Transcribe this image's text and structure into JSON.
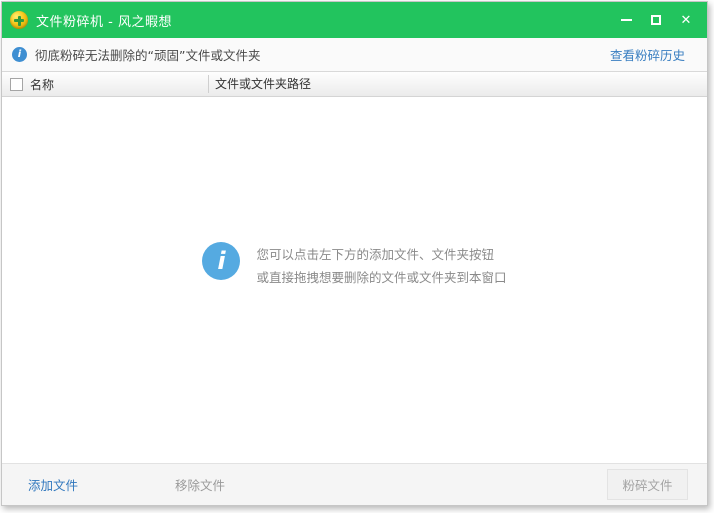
{
  "window": {
    "title": "文件粉碎机 - 风之暇想"
  },
  "infobar": {
    "text": "彻底粉碎无法删除的“顽固”文件或文件夹",
    "history_link": "查看粉碎历史"
  },
  "table": {
    "columns": [
      "名称",
      "文件或文件夹路径"
    ],
    "rows": []
  },
  "empty_hint": {
    "line1": "您可以点击左下方的添加文件、文件夹按钮",
    "line2": "或直接拖拽想要删除的文件或文件夹到本窗口"
  },
  "footer": {
    "add_label": "添加文件",
    "remove_label": "移除文件",
    "shred_label": "粉碎文件"
  },
  "icons": {
    "info_glyph": "i",
    "close_glyph": "✕"
  },
  "colors": {
    "titlebar_green": "#22c45e",
    "link_blue": "#3178be",
    "history_link_blue": "#3a7fc1",
    "info_icon_blue": "#55aae1",
    "small_info_icon_blue": "#3f8fd2",
    "disabled_text": "#a3a3a3"
  }
}
